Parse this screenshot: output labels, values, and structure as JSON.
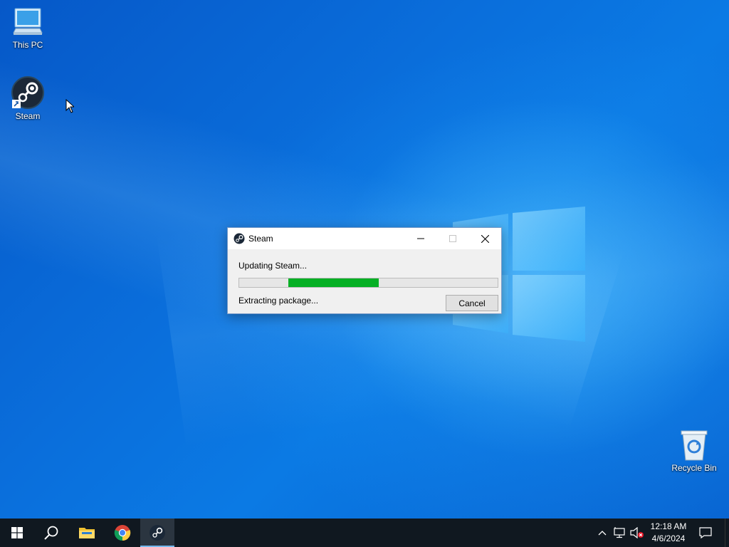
{
  "desktop": {
    "icons": [
      {
        "label": "This PC",
        "icon": "computer-icon"
      },
      {
        "label": "Steam",
        "icon": "steam-icon"
      },
      {
        "label": "Recycle Bin",
        "icon": "recycle-bin-icon"
      }
    ]
  },
  "dialog": {
    "title": "Steam",
    "status": "Updating Steam...",
    "detail": "Extracting package...",
    "cancel_label": "Cancel",
    "progress": {
      "start_fraction": 0.19,
      "fill_fraction": 0.35,
      "color": "#06b025"
    }
  },
  "taskbar": {
    "pinned": [
      "windows-start-icon",
      "search-icon",
      "file-explorer-icon",
      "chrome-icon",
      "steam-icon"
    ],
    "active": "steam-icon",
    "clock": {
      "time": "12:18 AM",
      "date": "4/6/2024"
    }
  },
  "colors": {
    "desktop_blue": "#0a6fdc",
    "taskbar": "#101820",
    "accent": "#76b9ed"
  }
}
